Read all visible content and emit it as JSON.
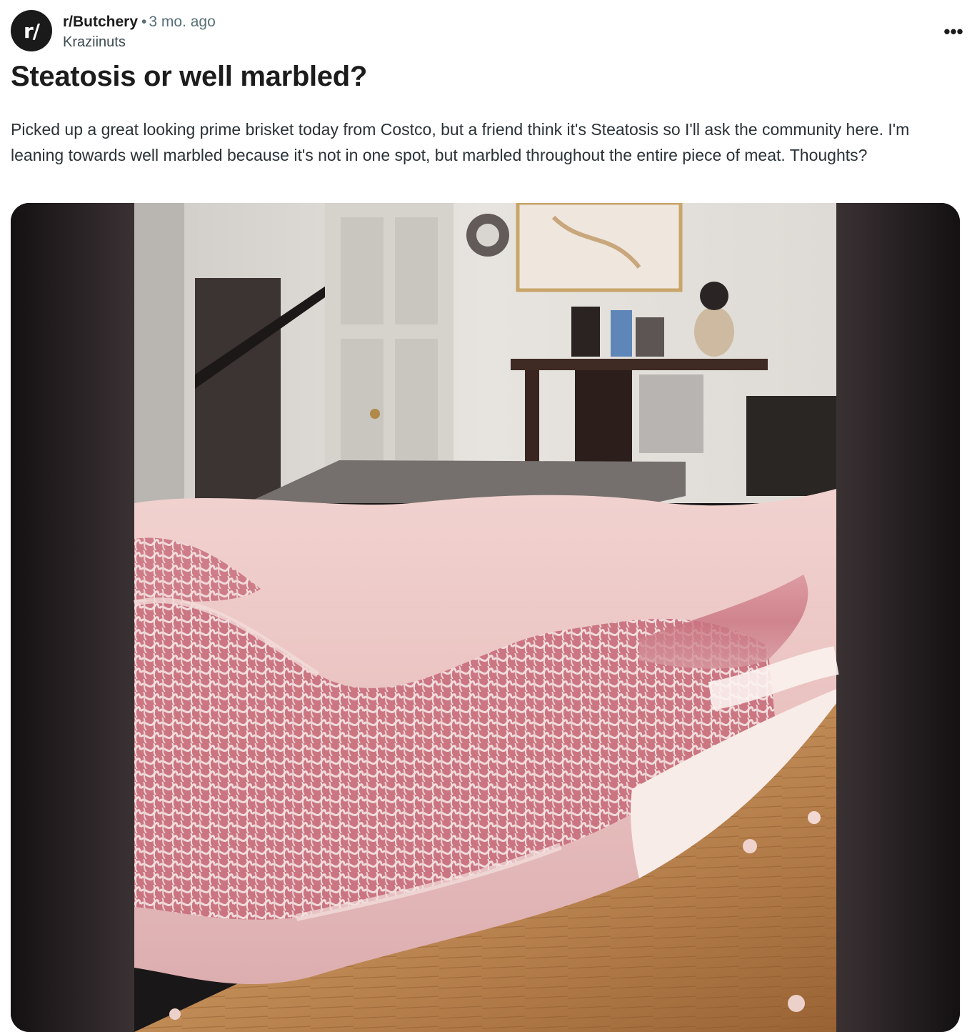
{
  "post": {
    "avatar_text": "r/",
    "subreddit": "r/Butchery",
    "separator": "•",
    "time_ago": "3 mo. ago",
    "author": "Kraziinuts",
    "more_label": "•••",
    "title": "Steatosis or well marbled?",
    "body": "Picked up a great looking prime brisket today from Costco, but a friend think it's Steatosis so I'll ask the community here. I'm leaning towards well marbled because it's not in one spot, but marbled throughout the entire piece of meat. Thoughts?"
  },
  "icons": {
    "more": "more-options-icon",
    "avatar": "subreddit-avatar-icon"
  },
  "colors": {
    "meta_gray": "#576f76",
    "avatar_bg": "#1a1a1b",
    "media_bg": "#1a1718"
  }
}
